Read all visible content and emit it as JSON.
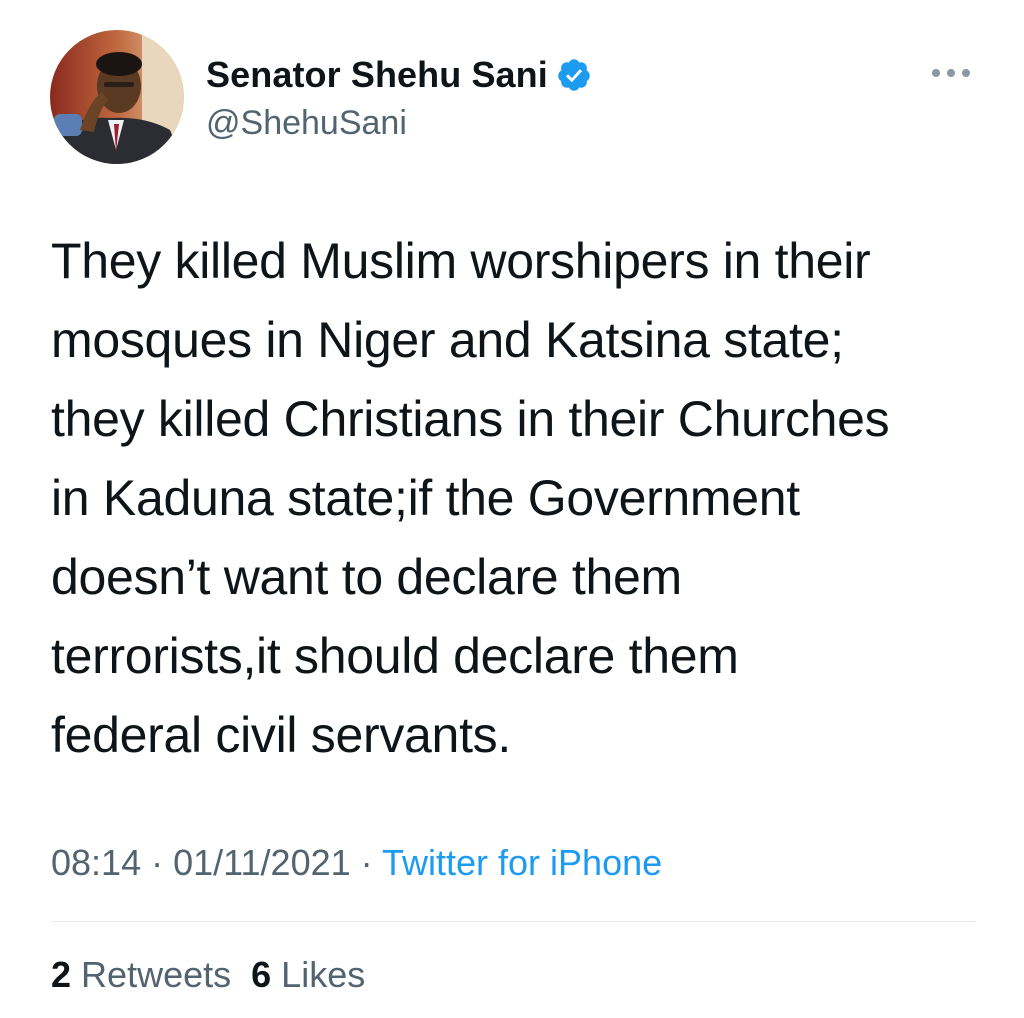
{
  "author": {
    "display_name": "Senator Shehu Sani",
    "handle": "@ShehuSani",
    "verified": true,
    "verified_icon": "verified-badge-icon",
    "avatar_icon": "profile-photo"
  },
  "menu_icon": "more-horizontal-icon",
  "tweet": {
    "text": "They killed Muslim worshipers in their\nmosques in Niger and Katsina state;\nthey killed Christians in their Churches\nin Kaduna state;if the Government\ndoesn’t want to declare them\nterrorists,it should declare them\nfederal civil servants."
  },
  "meta": {
    "time": "08:14",
    "separator": "·",
    "date": "01/11/2021",
    "source": "Twitter for iPhone"
  },
  "stats": {
    "retweets_count": "2",
    "retweets_label": "Retweets",
    "likes_count": "6",
    "likes_label": "Likes"
  },
  "colors": {
    "text": "#0f1419",
    "secondary": "#536471",
    "link": "#1d9bf0",
    "verified": "#1d9bf0",
    "divider": "#e6e9ec"
  }
}
